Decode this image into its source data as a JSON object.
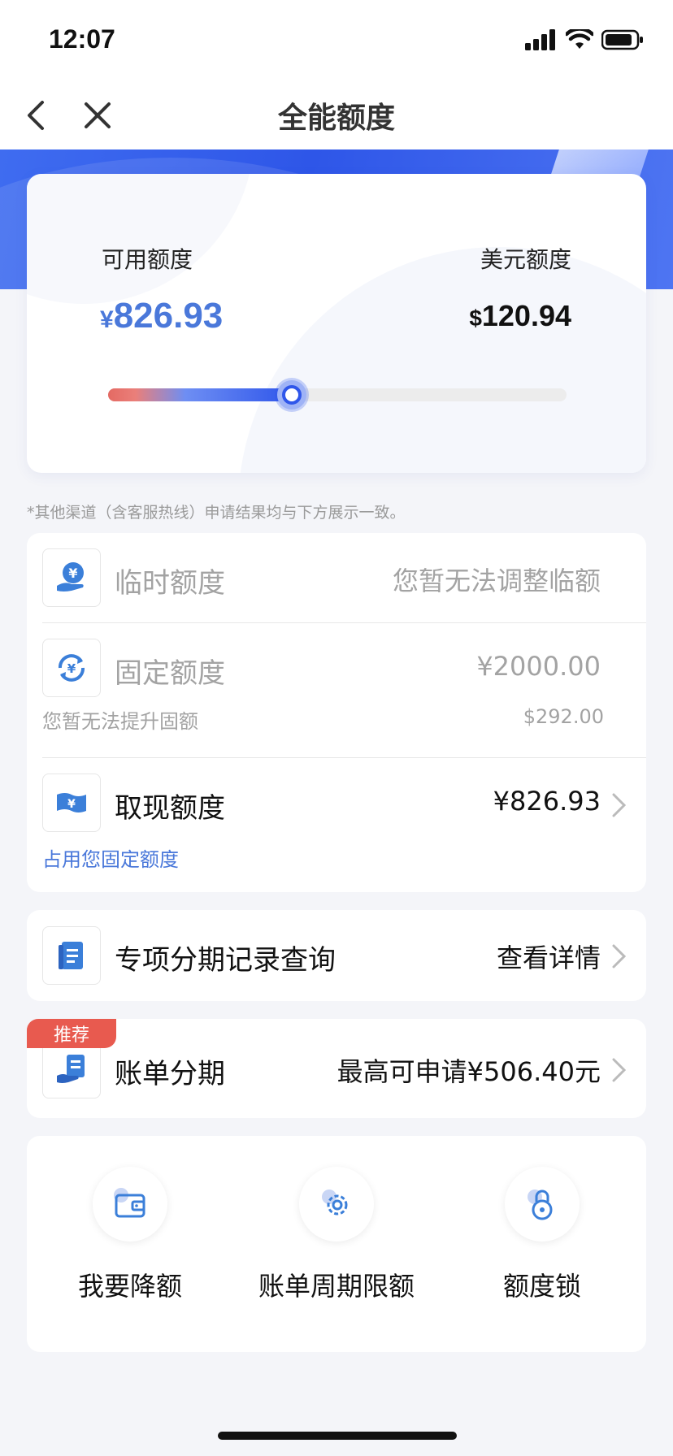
{
  "status_bar": {
    "time": "12:07"
  },
  "nav": {
    "title": "全能额度"
  },
  "quota": {
    "available_label": "可用额度",
    "available_currency": "¥",
    "available_value": "826.93",
    "usd_label": "美元额度",
    "usd_currency": "$",
    "usd_value": "120.94",
    "usage_fraction": 0.4
  },
  "note": "*其他渠道（含客服热线）申请结果均与下方展示一致。",
  "quota_list": {
    "temporary": {
      "title": "临时额度",
      "value": "您暂无法调整临额",
      "icon": "hand-yen-icon"
    },
    "fixed": {
      "title": "固定额度",
      "value": "¥2000.00",
      "sub_left": "您暂无法提升固额",
      "sub_right": "$292.00",
      "icon": "yen-cycle-icon"
    },
    "cash": {
      "title": "取现额度",
      "value": "¥826.93",
      "sub_left": "占用您固定额度",
      "icon": "banknote-icon"
    }
  },
  "installment_records": {
    "title": "专项分期记录查询",
    "value": "查看详情",
    "icon": "document-icon"
  },
  "bill_installment": {
    "badge": "推荐",
    "title": "账单分期",
    "value": "最高可申请¥506.40元",
    "icon": "bill-hand-icon"
  },
  "shortcuts": [
    {
      "label": "我要降额",
      "icon": "wallet-icon"
    },
    {
      "label": "账单周期限额",
      "icon": "gear-icon"
    },
    {
      "label": "额度锁",
      "icon": "lock-icon"
    }
  ],
  "colors": {
    "accent_blue": "#2f56ea",
    "amount_blue": "#4a78da",
    "badge_red": "#e85a4f",
    "slider_red": "#e46a63"
  }
}
